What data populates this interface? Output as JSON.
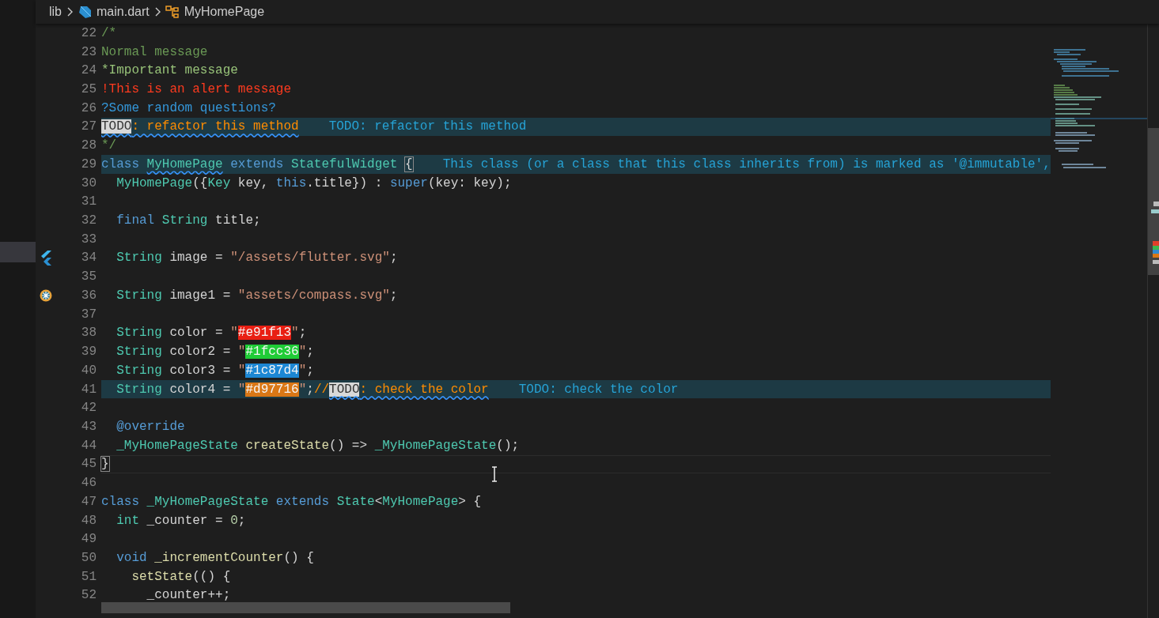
{
  "breadcrumb": [
    "lib",
    "main.dart",
    "MyHomePage"
  ],
  "lines": [
    {
      "number": "22",
      "highlight": false,
      "current": false,
      "tokens": [
        {
          "text": "/*",
          "kind": "comment"
        }
      ]
    },
    {
      "number": "23",
      "highlight": false,
      "current": false,
      "tokens": [
        {
          "text": "Normal message",
          "kind": "comment"
        }
      ]
    },
    {
      "number": "24",
      "highlight": false,
      "current": false,
      "tokens": [
        {
          "text": "*Important message",
          "kind": "important"
        }
      ]
    },
    {
      "number": "25",
      "highlight": false,
      "current": false,
      "tokens": [
        {
          "text": "!This is an alert message",
          "kind": "alert"
        }
      ]
    },
    {
      "number": "26",
      "highlight": false,
      "current": false,
      "tokens": [
        {
          "text": "?Some random questions?",
          "kind": "question"
        }
      ]
    },
    {
      "number": "27",
      "highlight": true,
      "current": false,
      "tokens": [
        {
          "text": "TODO",
          "kind": "todo-tag",
          "warning": true
        },
        {
          "text": ": refactor this method",
          "kind": "todo",
          "warning": true
        },
        {
          "text": "TODO: refactor this method",
          "kind": "hint"
        }
      ]
    },
    {
      "number": "28",
      "highlight": false,
      "current": false,
      "tokens": [
        {
          "text": "*/",
          "kind": "comment"
        }
      ]
    },
    {
      "number": "29",
      "highlight": true,
      "current": false,
      "tokens": [
        {
          "text": "class ",
          "kind": "keyword"
        },
        {
          "text": "MyHomePage",
          "kind": "type",
          "warning": true
        },
        {
          "text": " extends",
          "kind": "keyword"
        },
        {
          "text": " StatefulWidget ",
          "kind": "type"
        },
        {
          "text": "{",
          "kind": "bracket"
        },
        {
          "text": "This class (or a class that this class inherits from) is marked as '@immutable',",
          "kind": "hint"
        }
      ]
    },
    {
      "number": "30",
      "highlight": false,
      "current": false,
      "tokens": [
        {
          "text": "  MyHomePage",
          "kind": "type"
        },
        {
          "text": "({",
          "kind": "plain"
        },
        {
          "text": "Key",
          "kind": "type"
        },
        {
          "text": " key, ",
          "kind": "plain"
        },
        {
          "text": "this",
          "kind": "keyword"
        },
        {
          "text": ".title}) : ",
          "kind": "plain"
        },
        {
          "text": "super",
          "kind": "keyword"
        },
        {
          "text": "(key: key);",
          "kind": "plain"
        }
      ]
    },
    {
      "number": "31",
      "highlight": false,
      "current": false
    },
    {
      "number": "32",
      "highlight": false,
      "current": false,
      "tokens": [
        {
          "text": "  final",
          "kind": "keyword"
        },
        {
          "text": " String",
          "kind": "type"
        },
        {
          "text": " title;",
          "kind": "plain"
        }
      ]
    },
    {
      "number": "33",
      "highlight": false,
      "current": false
    },
    {
      "number": "34",
      "highlight": false,
      "current": false,
      "gutter": {
        "kind": "flutter"
      },
      "tokens": [
        {
          "text": "  String",
          "kind": "type"
        },
        {
          "text": " image = ",
          "kind": "plain"
        },
        {
          "text": "\"/assets/flutter.svg\"",
          "kind": "string"
        },
        {
          "text": ";",
          "kind": "plain"
        }
      ]
    },
    {
      "number": "35",
      "highlight": false,
      "current": false
    },
    {
      "number": "36",
      "highlight": false,
      "current": false,
      "gutter": {
        "kind": "compass"
      },
      "tokens": [
        {
          "text": "  String",
          "kind": "type"
        },
        {
          "text": " image1 = ",
          "kind": "plain"
        },
        {
          "text": "\"assets/compass.svg\"",
          "kind": "string"
        },
        {
          "text": ";",
          "kind": "plain"
        }
      ]
    },
    {
      "number": "37",
      "highlight": false,
      "current": false
    },
    {
      "number": "38",
      "highlight": false,
      "current": false,
      "tokens": [
        {
          "text": "  String",
          "kind": "type"
        },
        {
          "text": " color = ",
          "kind": "plain"
        },
        {
          "text": "\"",
          "kind": "string"
        },
        {
          "text": "#e91f13",
          "kind": "swatch",
          "color": "#e91f13"
        },
        {
          "text": "\"",
          "kind": "string"
        },
        {
          "text": ";",
          "kind": "plain"
        }
      ]
    },
    {
      "number": "39",
      "highlight": false,
      "current": false,
      "tokens": [
        {
          "text": "  String",
          "kind": "type"
        },
        {
          "text": " color2 = ",
          "kind": "plain"
        },
        {
          "text": "\"",
          "kind": "string"
        },
        {
          "text": "#1fcc36",
          "kind": "swatch",
          "color": "#1fcc36"
        },
        {
          "text": "\"",
          "kind": "string"
        },
        {
          "text": ";",
          "kind": "plain"
        }
      ]
    },
    {
      "number": "40",
      "highlight": false,
      "current": false,
      "tokens": [
        {
          "text": "  String",
          "kind": "type"
        },
        {
          "text": " color3 = ",
          "kind": "plain"
        },
        {
          "text": "\"",
          "kind": "string"
        },
        {
          "text": "#1c87d4",
          "kind": "swatch",
          "color": "#1c87d4"
        },
        {
          "text": "\"",
          "kind": "string"
        },
        {
          "text": ";",
          "kind": "plain"
        }
      ]
    },
    {
      "number": "41",
      "highlight": true,
      "current": false,
      "tokens": [
        {
          "text": "  String",
          "kind": "type"
        },
        {
          "text": " color4 = ",
          "kind": "plain"
        },
        {
          "text": "\"",
          "kind": "string"
        },
        {
          "text": "#d97716",
          "kind": "swatch",
          "color": "#d97716"
        },
        {
          "text": "\"",
          "kind": "string"
        },
        {
          "text": ";",
          "kind": "plain"
        },
        {
          "text": "//",
          "kind": "todo"
        },
        {
          "text": "TODO",
          "kind": "todo-tag",
          "warning": true
        },
        {
          "text": ": check the color",
          "kind": "todo",
          "warning": true
        },
        {
          "text": "TODO: check the color",
          "kind": "hint"
        }
      ]
    },
    {
      "number": "42",
      "highlight": false,
      "current": false
    },
    {
      "number": "43",
      "highlight": false,
      "current": false,
      "tokens": [
        {
          "text": "  @override",
          "kind": "keyword"
        }
      ]
    },
    {
      "number": "44",
      "highlight": false,
      "current": false,
      "tokens": [
        {
          "text": "  _MyHomePageState",
          "kind": "type"
        },
        {
          "text": " createState",
          "kind": "function"
        },
        {
          "text": "() => ",
          "kind": "plain"
        },
        {
          "text": "_MyHomePageState",
          "kind": "type"
        },
        {
          "text": "();",
          "kind": "plain"
        }
      ]
    },
    {
      "number": "45",
      "highlight": false,
      "current": true,
      "tokens": [
        {
          "text": "}",
          "kind": "bracket"
        }
      ]
    },
    {
      "number": "46",
      "highlight": false,
      "current": false
    },
    {
      "number": "47",
      "highlight": false,
      "current": false,
      "tokens": [
        {
          "text": "class",
          "kind": "keyword"
        },
        {
          "text": " _MyHomePageState",
          "kind": "type"
        },
        {
          "text": " extends",
          "kind": "keyword"
        },
        {
          "text": " State",
          "kind": "type"
        },
        {
          "text": "<",
          "kind": "plain"
        },
        {
          "text": "MyHomePage",
          "kind": "type"
        },
        {
          "text": "> {",
          "kind": "plain"
        }
      ]
    },
    {
      "number": "48",
      "highlight": false,
      "current": false,
      "tokens": [
        {
          "text": "  int",
          "kind": "type"
        },
        {
          "text": " _counter = ",
          "kind": "plain"
        },
        {
          "text": "0",
          "kind": "number"
        },
        {
          "text": ";",
          "kind": "plain"
        }
      ]
    },
    {
      "number": "49",
      "highlight": false,
      "current": false
    },
    {
      "number": "50",
      "highlight": false,
      "current": false,
      "tokens": [
        {
          "text": "  void",
          "kind": "keyword"
        },
        {
          "text": " _incrementCounter",
          "kind": "function"
        },
        {
          "text": "() {",
          "kind": "plain"
        }
      ]
    },
    {
      "number": "51",
      "highlight": false,
      "current": false,
      "tokens": [
        {
          "text": "    setState",
          "kind": "function"
        },
        {
          "text": "(() {",
          "kind": "plain"
        }
      ]
    },
    {
      "number": "52",
      "highlight": false,
      "current": false,
      "tokens": [
        {
          "text": "      _counter++;",
          "kind": "plain"
        }
      ]
    }
  ]
}
